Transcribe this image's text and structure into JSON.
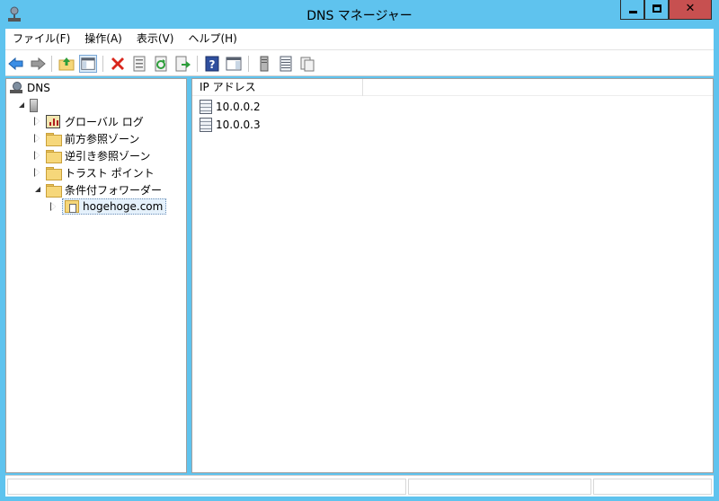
{
  "window": {
    "title": "DNS マネージャー",
    "minimize_label": "minimize",
    "maximize_label": "maximize",
    "close_glyph": "✕"
  },
  "menu": [
    "ファイル(F)",
    "操作(A)",
    "表示(V)",
    "ヘルプ(H)"
  ],
  "toolbar": {
    "buttons": [
      "back-icon",
      "forward-icon",
      "up-folder-icon",
      "show-hide-console-tree-icon",
      "delete-icon",
      "properties-icon",
      "refresh-icon",
      "export-list-icon",
      "help-icon",
      "show-hide-action-pane-icon",
      "server-icon",
      "list-icon",
      "copy-icon"
    ]
  },
  "tree": {
    "root": "DNS",
    "server": "",
    "nodes": [
      "グローバル ログ",
      "前方参照ゾーン",
      "逆引き参照ゾーン",
      "トラスト ポイント",
      "条件付フォワーダー"
    ],
    "child": "hogehoge.com"
  },
  "list": {
    "column": "IP アドレス",
    "rows": [
      "10.0.0.2",
      "10.0.0.3"
    ]
  },
  "colors": {
    "frame": "#5fc3ee",
    "close_button": "#c75050",
    "delete_icon": "#d9261c"
  }
}
